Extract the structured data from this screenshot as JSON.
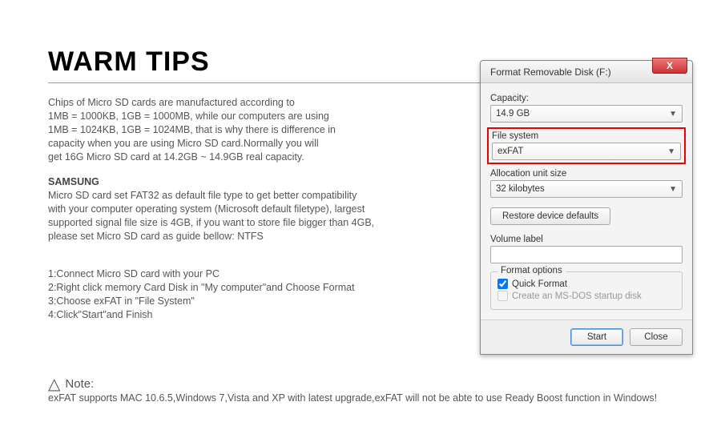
{
  "title": "WARM TIPS",
  "para1": "Chips of Micro SD cards are manufactured according to\n1MB = 1000KB, 1GB = 1000MB, while our computers are using\n1MB = 1024KB, 1GB = 1024MB, that is why there is difference in\ncapacity when you are using Micro SD card.Normally you will\nget 16G Micro SD card at 14.2GB ~ 14.9GB real capacity.",
  "subtitle": "SAMSUNG",
  "para2": "Micro SD card set FAT32 as default file type to get better compatibility\nwith your computer operating system (Microsoft default filetype), largest\nsupported signal file size is 4GB, if you want to store file bigger than 4GB,\nplease set Micro SD card as guide bellow: NTFS",
  "steps": "1:Connect Micro SD card with your PC\n2:Right click memory Card Disk in \"My computer\"and Choose Format\n3:Choose exFAT in \"File System\"\n4:Click\"Start\"and Finish",
  "note_label": "Note:",
  "note_body": "exFAT supports MAC 10.6.5,Windows 7,Vista and XP with latest upgrade,exFAT will not be abte to use Ready Boost function in Windows!",
  "dialog": {
    "title": "Format Removable Disk (F:)",
    "capacity_label": "Capacity:",
    "capacity_value": "14.9 GB",
    "filesystem_label": "File system",
    "filesystem_value": "exFAT",
    "allocation_label": "Allocation unit size",
    "allocation_value": "32 kilobytes",
    "restore_btn": "Restore device defaults",
    "volume_label": "Volume label",
    "volume_value": "",
    "format_options": "Format options",
    "quick_format": "Quick Format",
    "msdos": "Create an MS-DOS startup disk",
    "start": "Start",
    "close": "Close"
  }
}
